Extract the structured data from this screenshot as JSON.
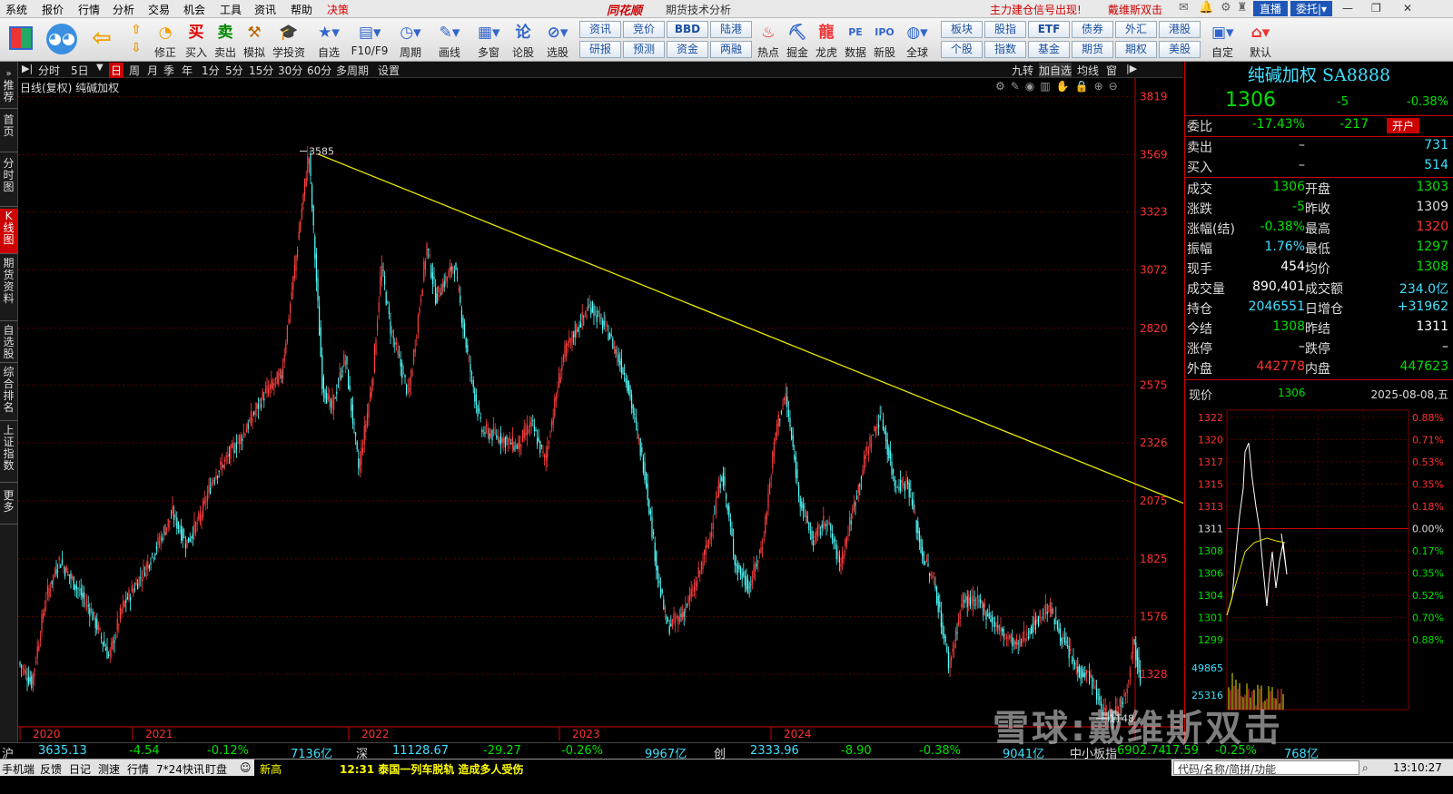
{
  "menu": [
    "系统",
    "报价",
    "行情",
    "分析",
    "交易",
    "机会",
    "工具",
    "资讯",
    "帮助",
    "决策"
  ],
  "app_logo": "同花顺",
  "window_title": "期货技术分析",
  "alert": "主力建仓信号出现!",
  "user": "戴维斯双击",
  "live_button": "直播",
  "delegate_button": "委托",
  "toolbar": [
    "修正",
    "买入",
    "卖出",
    "模拟",
    "学投资",
    "自选",
    "F10/F9",
    "周期",
    "画线",
    "多窗",
    "论股",
    "选股",
    "热点",
    "掘金",
    "龙虎",
    "数据",
    "新股",
    "全球",
    "自定",
    "默认"
  ],
  "small_buttons": [
    [
      "资讯",
      "研报"
    ],
    [
      "竞价",
      "预测"
    ],
    [
      "BBD",
      "资金"
    ],
    [
      "陆港",
      "两融"
    ],
    [
      "板块",
      "个股"
    ],
    [
      "股指",
      "指数"
    ],
    [
      "ETF",
      "基金"
    ],
    [
      "债券",
      "期货"
    ],
    [
      "外汇",
      "期权"
    ],
    [
      "港股",
      "美股"
    ]
  ],
  "left_tabs": [
    "推荐",
    "首页",
    "分时图",
    "K线图",
    "期货资料",
    "自选股",
    "综合排名",
    "上证指数",
    "更多"
  ],
  "period_bar": [
    "分时",
    "5日",
    "日",
    "周",
    "月",
    "季",
    "年",
    "1分",
    "5分",
    "15分",
    "30分",
    "60分",
    "多周期",
    "设置"
  ],
  "period_right": [
    "九转",
    "加自选",
    "均线",
    "窗"
  ],
  "chart_header": "日线(复权) 纯碱加权",
  "chart_data": {
    "type": "candlestick",
    "y_ticks": [
      3819,
      3569,
      3323,
      3072,
      2820,
      2575,
      2326,
      2075,
      1825,
      1576,
      1328
    ],
    "ylim": [
      1100,
      3900
    ],
    "x_ticks": [
      "2020",
      "2021",
      "2022",
      "2023",
      "2024"
    ],
    "high_label": "3585",
    "low_label": "1148",
    "path": [
      [
        0,
        1380
      ],
      [
        15,
        1290
      ],
      [
        30,
        1650
      ],
      [
        45,
        1820
      ],
      [
        60,
        1730
      ],
      [
        80,
        1600
      ],
      [
        100,
        1400
      ],
      [
        115,
        1620
      ],
      [
        135,
        1750
      ],
      [
        150,
        1860
      ],
      [
        170,
        2020
      ],
      [
        185,
        1890
      ],
      [
        200,
        2000
      ],
      [
        215,
        2180
      ],
      [
        230,
        2260
      ],
      [
        250,
        2380
      ],
      [
        270,
        2530
      ],
      [
        290,
        2620
      ],
      [
        305,
        3100
      ],
      [
        320,
        3585
      ],
      [
        335,
        2580
      ],
      [
        345,
        2470
      ],
      [
        360,
        2700
      ],
      [
        375,
        2210
      ],
      [
        390,
        2600
      ],
      [
        400,
        3090
      ],
      [
        410,
        2820
      ],
      [
        430,
        2530
      ],
      [
        450,
        3180
      ],
      [
        460,
        2950
      ],
      [
        480,
        3100
      ],
      [
        495,
        2700
      ],
      [
        510,
        2380
      ],
      [
        530,
        2350
      ],
      [
        550,
        2310
      ],
      [
        565,
        2410
      ],
      [
        580,
        2250
      ],
      [
        600,
        2700
      ],
      [
        615,
        2820
      ],
      [
        630,
        2920
      ],
      [
        650,
        2800
      ],
      [
        670,
        2600
      ],
      [
        690,
        2200
      ],
      [
        705,
        1730
      ],
      [
        715,
        1530
      ],
      [
        730,
        1580
      ],
      [
        745,
        1700
      ],
      [
        760,
        1900
      ],
      [
        775,
        2200
      ],
      [
        790,
        1800
      ],
      [
        805,
        1700
      ],
      [
        820,
        1900
      ],
      [
        835,
        2400
      ],
      [
        845,
        2530
      ],
      [
        860,
        2100
      ],
      [
        875,
        1900
      ],
      [
        890,
        2000
      ],
      [
        905,
        1800
      ],
      [
        920,
        2050
      ],
      [
        935,
        2300
      ],
      [
        950,
        2450
      ],
      [
        965,
        2150
      ],
      [
        980,
        2150
      ],
      [
        995,
        1850
      ],
      [
        1010,
        1700
      ],
      [
        1025,
        1360
      ],
      [
        1040,
        1650
      ],
      [
        1060,
        1630
      ],
      [
        1080,
        1520
      ],
      [
        1100,
        1450
      ],
      [
        1120,
        1550
      ],
      [
        1135,
        1620
      ],
      [
        1150,
        1480
      ],
      [
        1165,
        1350
      ],
      [
        1180,
        1320
      ],
      [
        1195,
        1160
      ],
      [
        1205,
        1150
      ],
      [
        1220,
        1250
      ],
      [
        1228,
        1480
      ],
      [
        1236,
        1310
      ]
    ],
    "trendline": {
      "from": [
        330,
        3572
      ],
      "to": [
        1283,
        2065
      ]
    }
  },
  "quote": {
    "title": "纯碱加权 SA8888",
    "price": "1306",
    "change": "-5",
    "change_pct": "-0.38%",
    "wb_label": "委比",
    "wb_pct": "-17.43%",
    "wb_val": "-217",
    "open_label": "开户",
    "sell_label": "卖出",
    "sell_px": "–",
    "sell_qty": "731",
    "buy_label": "买入",
    "buy_px": "–",
    "buy_qty": "514",
    "rows": [
      {
        "k1": "成交",
        "v1": "1306",
        "c1": "#00e000",
        "k2": "开盘",
        "v2": "1303",
        "c2": "#00e000"
      },
      {
        "k1": "涨跌",
        "v1": "-5",
        "c1": "#00e000",
        "k2": "昨收",
        "v2": "1309",
        "c2": "#ddd"
      },
      {
        "k1": "涨幅(结)",
        "v1": "-0.38%",
        "c1": "#00e000",
        "k2": "最高",
        "v2": "1320",
        "c2": "#ff3030"
      },
      {
        "k1": "振幅",
        "v1": "1.76%",
        "c1": "#40e0ff",
        "k2": "最低",
        "v2": "1297",
        "c2": "#00e000"
      },
      {
        "k1": "现手",
        "v1": "454",
        "c1": "#fff",
        "k2": "均价",
        "v2": "1308",
        "c2": "#00e000"
      },
      {
        "k1": "成交量",
        "v1": "890,401",
        "c1": "#fff",
        "k2": "成交额",
        "v2": "234.0亿",
        "c2": "#40e0ff"
      },
      {
        "k1": "持仓",
        "v1": "2046551",
        "c1": "#40e0ff",
        "k2": "日增仓",
        "v2": "+31962",
        "c2": "#40e0ff"
      },
      {
        "k1": "今结",
        "v1": "1308",
        "c1": "#00e000",
        "k2": "昨结",
        "v2": "1311",
        "c2": "#fff"
      },
      {
        "k1": "涨停",
        "v1": "–",
        "c1": "#fff",
        "k2": "跌停",
        "v2": "–",
        "c2": "#fff"
      },
      {
        "k1": "外盘",
        "v1": "442778",
        "c1": "#ff3030",
        "k2": "内盘",
        "v2": "447623",
        "c2": "#00e000"
      }
    ],
    "mini_label": "现价",
    "mini_price": "1306",
    "mini_date": "2025-08-08,五",
    "mini_left_ticks": [
      "1322",
      "1320",
      "1317",
      "1315",
      "1313",
      "1311",
      "1308",
      "1306",
      "1304",
      "1301",
      "1299"
    ],
    "mini_right_ticks": [
      "0.88%",
      "0.71%",
      "0.53%",
      "0.35%",
      "0.18%",
      "0.00%",
      "0.17%",
      "0.35%",
      "0.52%",
      "0.70%",
      "0.88%"
    ],
    "mini_vol_ticks": [
      "49865",
      "25316"
    ]
  },
  "index_bar": [
    {
      "name": "沪",
      "val": "3635.13",
      "chg": "-4.54",
      "pct": "-0.12%",
      "amt": "7136亿"
    },
    {
      "name": "深",
      "val": "11128.67",
      "chg": "-29.27",
      "pct": "-0.26%",
      "amt": "9967亿"
    },
    {
      "name": "创",
      "val": "2333.96",
      "chg": "-8.90",
      "pct": "-0.38%",
      "amt": "9041亿"
    },
    {
      "name": "中小板指",
      "val": "6902.74",
      "chg": "-17.59",
      "pct": "-0.25%",
      "amt": "768亿"
    }
  ],
  "status": [
    "手机端",
    "反馈",
    "日记",
    "测速",
    "行情",
    "7*24快讯",
    "盯盘"
  ],
  "status_new_high": "新高",
  "news": "12:31 泰国一列车脱轨 造成多人受伤",
  "search_hint": "代码/名称/简拼/功能",
  "clock": "13:10:27",
  "watermark": "雪球:戴维斯双击"
}
